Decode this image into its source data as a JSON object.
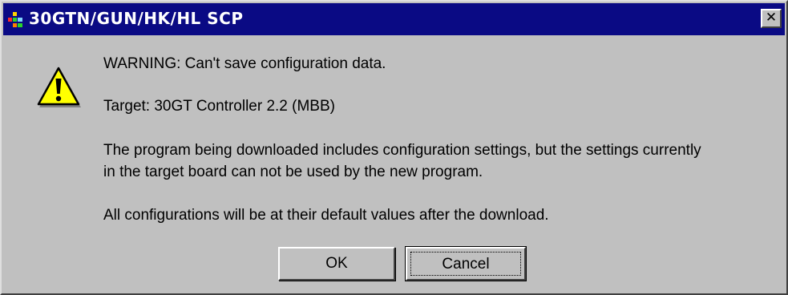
{
  "window": {
    "title": "30GTN/GUN/HK/HL SCP",
    "close_glyph": "✕"
  },
  "icons": {
    "app": "scp-app-icon",
    "message": "warning-icon"
  },
  "message": {
    "warning": "WARNING: Can't save configuration data.",
    "target": "Target: 30GT Controller 2.2 (MBB)",
    "body_line1": "The program being downloaded includes configuration settings, but the settings currently",
    "body_line2": "in the target board can not be used by the new program.",
    "defaults": "All configurations will be at their default values after the download."
  },
  "buttons": {
    "ok": "OK",
    "cancel": "Cancel"
  },
  "colors": {
    "titlebar": "#0a0a84",
    "dialog_face": "#c0c0c0",
    "warning_yellow": "#ffff00"
  }
}
